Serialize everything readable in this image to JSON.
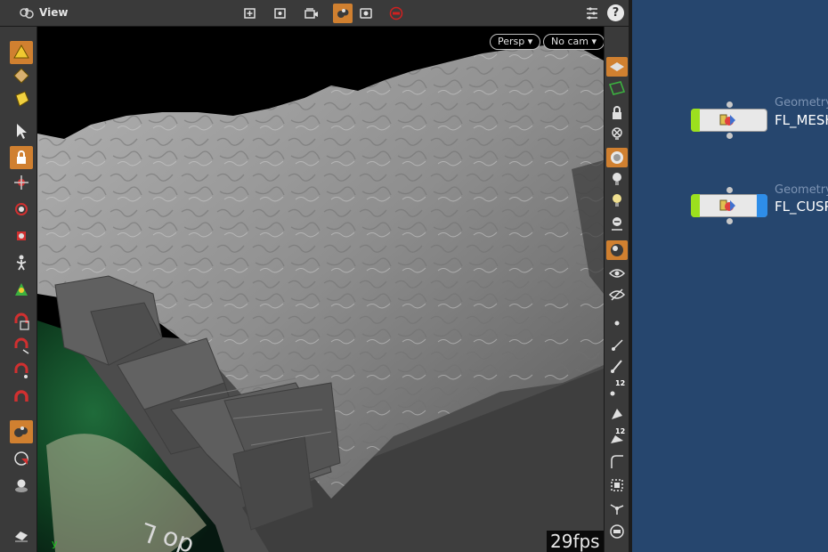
{
  "pane": {
    "title": "View",
    "help_label": "?"
  },
  "viewport": {
    "projection_label": "Persp",
    "camera_label": "No cam",
    "fps_label": "29fps",
    "axis_label": "y"
  },
  "right_toolbar": {
    "point_size_label_1": "12",
    "point_size_label_2": "12"
  },
  "network": {
    "nodes": [
      {
        "type": "Geometry",
        "name": "FL_MESH"
      },
      {
        "type": "Geometry",
        "name": "FL_CUSP"
      }
    ]
  },
  "colors": {
    "accent_active": "#d08030",
    "network_bg": "#26466e",
    "display_flag": "#9ce01e",
    "template_flag": "#2e8de8"
  }
}
